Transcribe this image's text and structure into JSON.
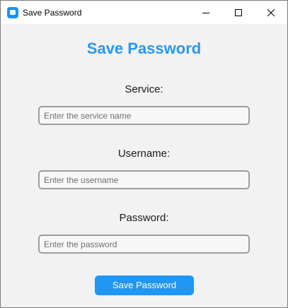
{
  "window": {
    "title": "Save Password",
    "accent_color": "#1e90ff"
  },
  "form": {
    "heading": "Save Password",
    "heading_color": "#2b97f0",
    "service": {
      "label": "Service:",
      "placeholder": "Enter the service name",
      "value": ""
    },
    "username": {
      "label": "Username:",
      "placeholder": "Enter the username",
      "value": ""
    },
    "password": {
      "label": "Password:",
      "placeholder": "Enter the password",
      "value": ""
    },
    "submit_label": "Save Password",
    "button_color": "#2196f3"
  },
  "icons": {
    "app": "app-icon",
    "minimize": "minimize-icon",
    "maximize": "maximize-icon",
    "close": "close-icon"
  }
}
